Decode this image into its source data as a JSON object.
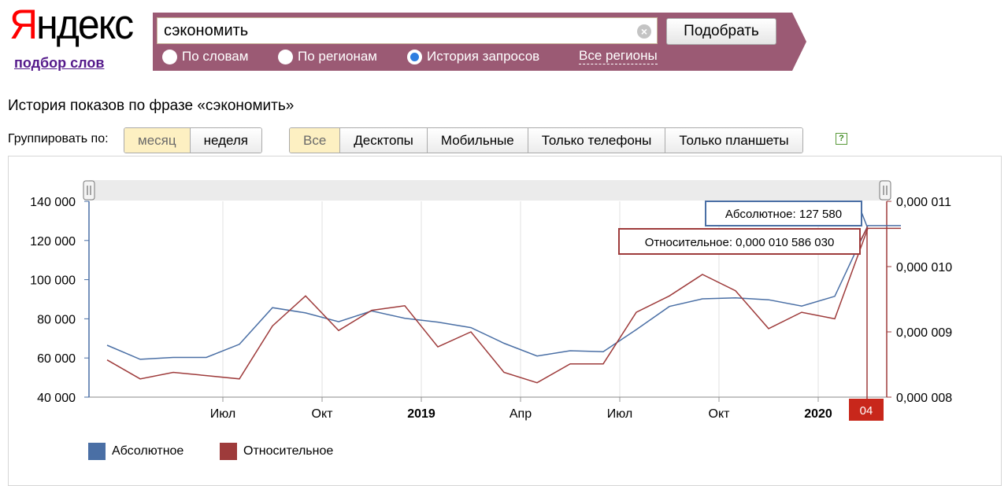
{
  "header": {
    "logo_first": "Я",
    "logo_rest": "ндекс",
    "subtitle": "подбор слов"
  },
  "search": {
    "query": "сэкономить",
    "clear_icon": "x-circle-icon",
    "submit_label": "Подобрать",
    "modes": [
      "По словам",
      "По регионам",
      "История запросов"
    ],
    "selected_mode": "История запросов",
    "regions_link": "Все регионы"
  },
  "page_title": "История показов по фразе «сэкономить»",
  "grouping": {
    "label": "Группировать по:",
    "options": [
      "месяц",
      "неделя"
    ],
    "selected": "месяц"
  },
  "devices": {
    "options": [
      "Все",
      "Десктопы",
      "Мобильные",
      "Только телефоны",
      "Только планшеты"
    ],
    "selected": "Все"
  },
  "help_icon": "?",
  "colors": {
    "absolute": "#4a6fa5",
    "relative": "#9e3b3b",
    "marker": "#c8271b",
    "accent": "#9b5a74"
  },
  "chart_data": {
    "type": "line",
    "x": [
      "2018-04",
      "2018-05",
      "2018-06",
      "2018-07",
      "2018-08",
      "2018-09",
      "2018-10",
      "2018-11",
      "2018-12",
      "2019-01",
      "2019-02",
      "2019-03",
      "2019-04",
      "2019-05",
      "2019-06",
      "2019-07",
      "2019-08",
      "2019-09",
      "2019-10",
      "2019-11",
      "2019-12",
      "2020-01",
      "2020-02",
      "2020-03",
      "2020-04"
    ],
    "x_tick_labels": [
      "Июл",
      "Окт",
      "2019",
      "Апр",
      "Июл",
      "Окт",
      "2020"
    ],
    "x_tick_months": [
      "2018-07",
      "2018-10",
      "2019-01",
      "2019-04",
      "2019-07",
      "2019-10",
      "2020-01"
    ],
    "y_left_ticks": [
      "140 000",
      "120 000",
      "100 000",
      "80 000",
      "60 000",
      "40 000"
    ],
    "y_left_range": [
      40000,
      140000
    ],
    "y_right_ticks": [
      "0,000 011",
      "0,000 010",
      "0,000 009",
      "0,000 008"
    ],
    "y_right_range": [
      8e-06,
      1.1e-05
    ],
    "series": [
      {
        "name": "Абсолютное",
        "axis": "left",
        "values": [
          66500,
          59300,
          60300,
          60300,
          67000,
          85700,
          83000,
          78500,
          84000,
          80300,
          78300,
          75500,
          67500,
          61000,
          63700,
          63200,
          74500,
          86300,
          90200,
          90700,
          89700,
          86500,
          91500,
          127580,
          127580
        ]
      },
      {
        "name": "Относительное",
        "axis": "right",
        "values": [
          8.57e-06,
          8.28e-06,
          8.38e-06,
          8.33e-06,
          8.28e-06,
          9.09e-06,
          9.55e-06,
          9.02e-06,
          9.33e-06,
          9.4e-06,
          8.77e-06,
          9e-06,
          8.38e-06,
          8.22e-06,
          8.51e-06,
          8.51e-06,
          9.3e-06,
          9.55e-06,
          9.88e-06,
          9.63e-06,
          9.05e-06,
          9.3e-06,
          9.2e-06,
          1.058603e-05,
          1.058603e-05
        ]
      }
    ],
    "tooltip_absolute": "Абсолютное: 127 580",
    "tooltip_relative": "Относительное: 0,000 010 586 030",
    "marker_label": "04",
    "legend": [
      "Абсолютное",
      "Относительное"
    ],
    "grid": "vertical"
  }
}
